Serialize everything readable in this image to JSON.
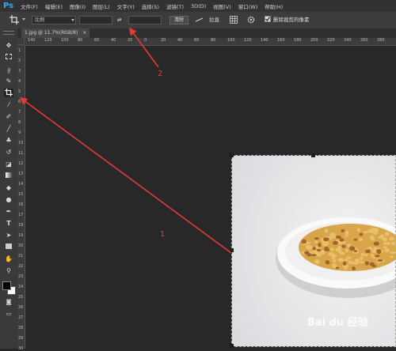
{
  "app": {
    "logo": "Ps"
  },
  "menu": [
    "文件(F)",
    "编辑(E)",
    "图像(I)",
    "图层(L)",
    "文字(Y)",
    "选择(S)",
    "滤镜(T)",
    "3D(D)",
    "视图(V)",
    "窗口(W)",
    "帮助(H)"
  ],
  "options": {
    "ratio_select": "比例",
    "swap_icon": "⇄",
    "clear_button": "清除",
    "straighten_label": "拉直",
    "delete_cropped_label": "删除裁剪的像素",
    "delete_cropped_checked": true
  },
  "document": {
    "tab_title": "1.jpg @ 11.7%(RGB/8)",
    "close": "×"
  },
  "ruler": {
    "h_labels": [
      "140",
      "120",
      "100",
      "80",
      "60",
      "40",
      "20",
      "0",
      "20",
      "40",
      "60",
      "80",
      "100",
      "120",
      "140",
      "160",
      "180",
      "200",
      "220",
      "240",
      "260",
      "280"
    ],
    "v_labels": [
      "1",
      "2",
      "3",
      "4",
      "5",
      "6",
      "7",
      "8",
      "9",
      "10",
      "11",
      "12",
      "13",
      "14",
      "15",
      "16",
      "17",
      "18",
      "19",
      "20",
      "21",
      "22",
      "23",
      "24",
      "25",
      "26",
      "27",
      "28",
      "29",
      "30"
    ]
  },
  "annotations": {
    "label1": "1",
    "label2": "2"
  },
  "colors": {
    "arrow": "#e23a3a",
    "accent": "#31a8ff"
  },
  "watermark": "Bai du 经验"
}
